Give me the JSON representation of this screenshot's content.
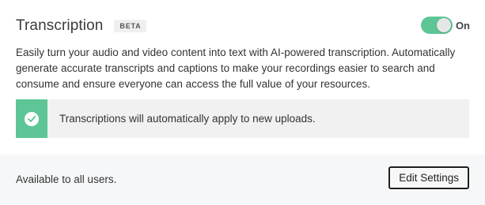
{
  "feature": {
    "title": "Transcription",
    "badge": "BETA",
    "toggle": {
      "state": "on",
      "label": "On",
      "color": "#5ec696"
    },
    "description": "Easily turn your audio and video content into text with AI-powered transcription. Automatically generate accurate transcripts and captions to make your recordings easier to search and consume and ensure everyone can access the full value of your resources."
  },
  "notice": {
    "icon": "check-circle-icon",
    "text": "Transcriptions will automatically apply to new uploads.",
    "accent": "#5ec696"
  },
  "footer": {
    "availability": "Available to all users.",
    "edit_button": "Edit Settings"
  }
}
